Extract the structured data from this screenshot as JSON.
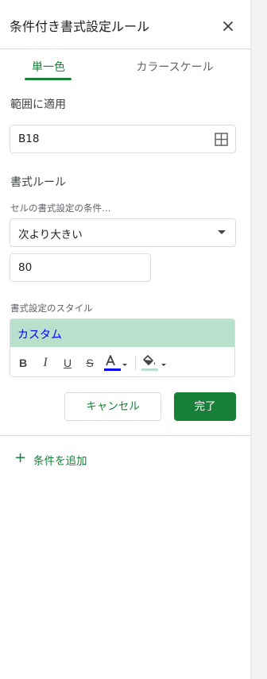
{
  "panel": {
    "title": "条件付き書式設定ルール"
  },
  "tabs": [
    {
      "label": "単一色",
      "active": true
    },
    {
      "label": "カラースケール",
      "active": false
    }
  ],
  "range": {
    "label": "範囲に適用",
    "value": "B18"
  },
  "rules": {
    "label": "書式ルール",
    "condition_label": "セルの書式設定の条件…",
    "condition_value": "次より大きい",
    "value_input": "80"
  },
  "style": {
    "label": "書式設定のスタイル",
    "preview_text": "カスタム",
    "preview_bg": "#b7e1cd",
    "text_color": "#0000ff",
    "fill_color": "#b7e1cd",
    "bold": "B",
    "italic": "I",
    "underline": "U",
    "strike": "S",
    "text_color_glyph": "A"
  },
  "buttons": {
    "cancel": "キャンセル",
    "done": "完了"
  },
  "add_rule": {
    "icon": "plus-icon",
    "label": "条件を追加"
  },
  "colors": {
    "accent": "#188038"
  }
}
